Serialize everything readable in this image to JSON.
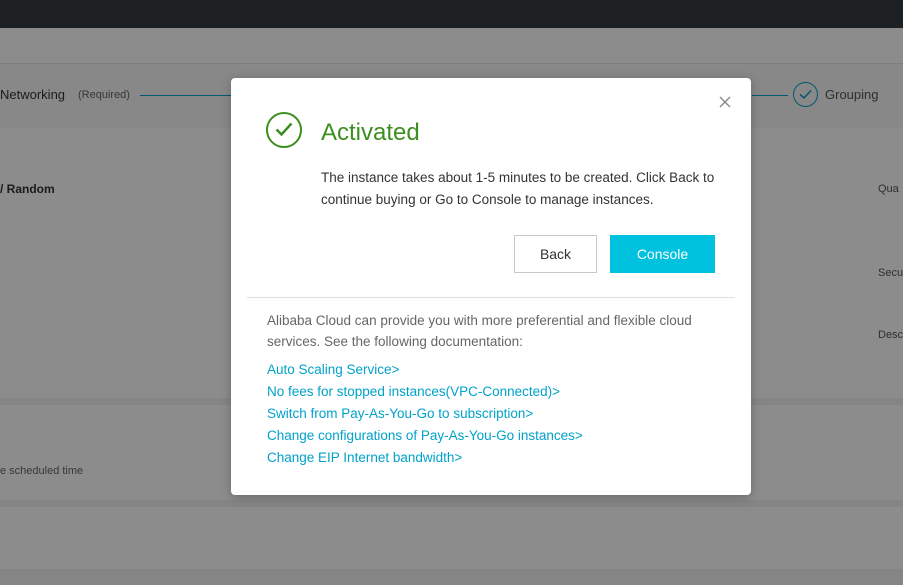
{
  "background": {
    "steps": {
      "networking_label": "Networking",
      "networking_required": "(Required)",
      "grouping_label": "Grouping"
    },
    "section_label": "/ Random",
    "right_labels": [
      "Qua",
      "Secu",
      "Desc"
    ],
    "scheduled_label": "e scheduled time"
  },
  "modal": {
    "title": "Activated",
    "message": "The instance takes about 1-5 minutes to be created. Click Back to continue buying or Go to Console to manage instances.",
    "back_label": "Back",
    "console_label": "Console",
    "promo_text": "Alibaba Cloud can provide you with more preferential and flexible cloud services. See the following documentation:",
    "links": [
      "Auto Scaling Service>",
      "No fees for stopped instances(VPC-Connected)>",
      "Switch from Pay-As-You-Go to subscription>",
      "Change configurations of Pay-As-You-Go instances>",
      "Change EIP Internet bandwidth>"
    ]
  },
  "colors": {
    "success": "#3c8e1e",
    "primary": "#00c1de",
    "link": "#00a2ca",
    "overlay": "rgba(0,0,0,0.45)"
  },
  "icons": {
    "close": "close-icon",
    "success": "check-circle-icon",
    "step": "check-circle-icon"
  }
}
